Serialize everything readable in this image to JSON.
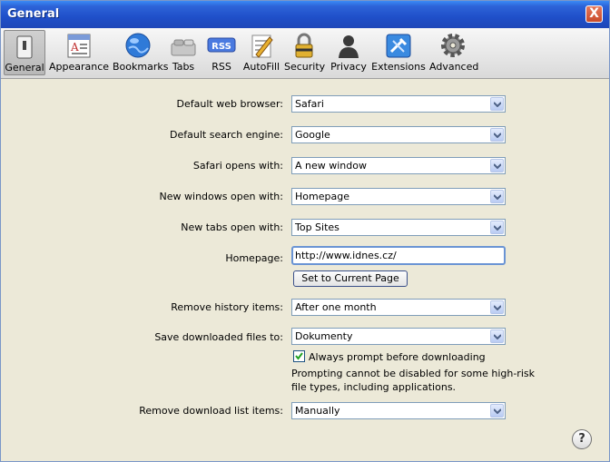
{
  "window": {
    "title": "General",
    "close_label": "X"
  },
  "toolbar": {
    "items": [
      {
        "label": "General",
        "icon": "general-switch-icon",
        "selected": true
      },
      {
        "label": "Appearance",
        "icon": "appearance-icon"
      },
      {
        "label": "Bookmarks",
        "icon": "globe-icon"
      },
      {
        "label": "Tabs",
        "icon": "tabs-icon"
      },
      {
        "label": "RSS",
        "icon": "rss-icon",
        "badge": "RSS"
      },
      {
        "label": "AutoFill",
        "icon": "autofill-pencil-icon"
      },
      {
        "label": "Security",
        "icon": "lock-icon"
      },
      {
        "label": "Privacy",
        "icon": "person-icon"
      },
      {
        "label": "Extensions",
        "icon": "extensions-icon"
      },
      {
        "label": "Advanced",
        "icon": "gear-icon"
      }
    ]
  },
  "settings": {
    "default_browser": {
      "label": "Default web browser:",
      "value": "Safari"
    },
    "search_engine": {
      "label": "Default search engine:",
      "value": "Google"
    },
    "opens_with": {
      "label": "Safari opens with:",
      "value": "A new window"
    },
    "new_windows": {
      "label": "New windows open with:",
      "value": "Homepage"
    },
    "new_tabs": {
      "label": "New tabs open with:",
      "value": "Top Sites"
    },
    "homepage": {
      "label": "Homepage:",
      "value": "http://www.idnes.cz/",
      "button": "Set to Current Page"
    },
    "history": {
      "label": "Remove history items:",
      "value": "After one month"
    },
    "downloads": {
      "label": "Save downloaded files to:",
      "value": "Dokumenty",
      "checkbox_label": "Always prompt before downloading",
      "note": "Prompting cannot be disabled for some high-risk file types, including applications."
    },
    "download_list": {
      "label": "Remove download list items:",
      "value": "Manually"
    }
  },
  "help": {
    "label": "?"
  },
  "colors": {
    "titlebar": "#2d63d8",
    "face": "#ece9d8",
    "close": "#d35a3a"
  }
}
